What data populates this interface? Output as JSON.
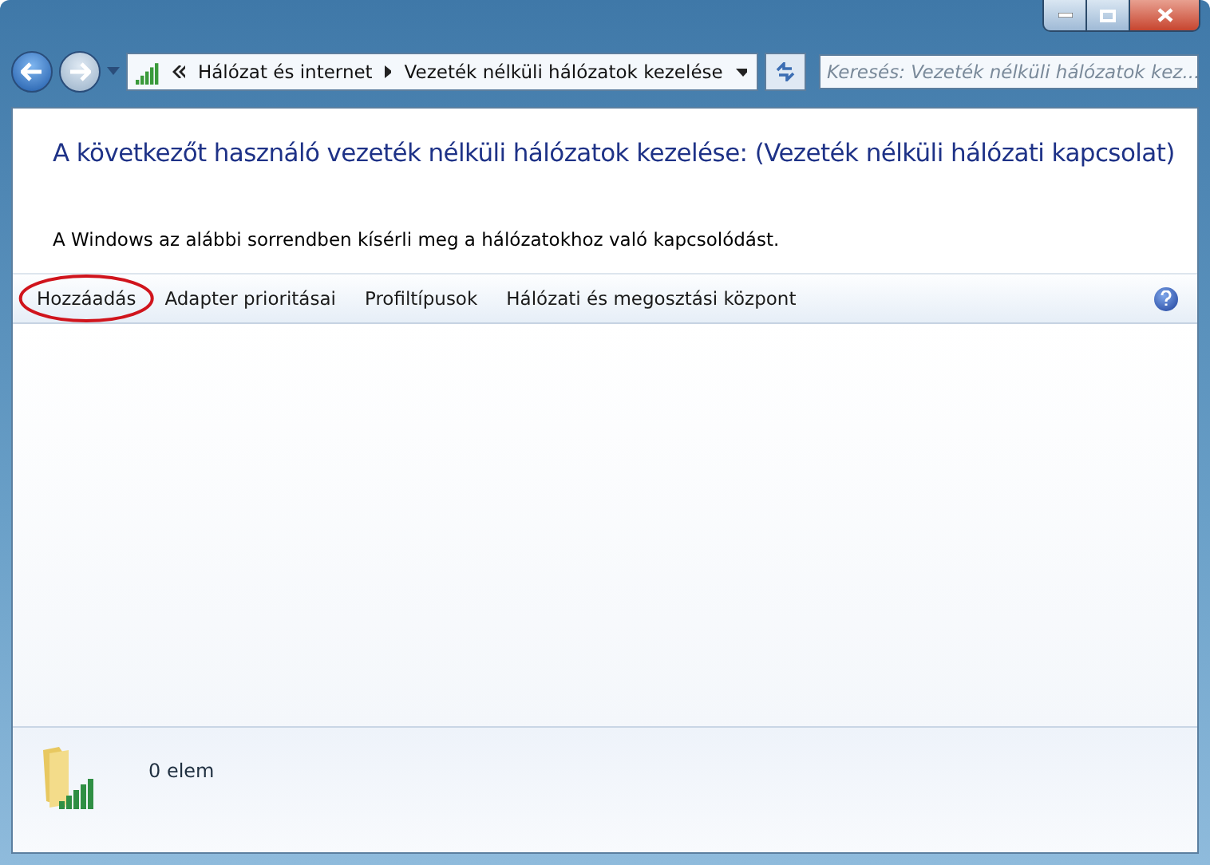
{
  "address_bar": {
    "crumbs": [
      "Hálózat és internet",
      "Vezeték nélküli hálózatok kezelése"
    ]
  },
  "search": {
    "placeholder": "Keresés: Vezeték nélküli hálózatok kez..."
  },
  "heading": "A következőt használó vezeték nélküli hálózatok kezelése: (Vezeték nélküli hálózati kapcsolat)",
  "description": "A Windows az alábbi sorrendben kísérli meg a hálózatokhoz való kapcsolódást.",
  "toolbar": [
    {
      "label": "Hozzáadás",
      "circled": true
    },
    {
      "label": "Adapter prioritásai",
      "circled": false
    },
    {
      "label": "Profiltípusok",
      "circled": false
    },
    {
      "label": "Hálózati és megosztási központ",
      "circled": false
    }
  ],
  "status_bar": {
    "count": "0 elem"
  }
}
